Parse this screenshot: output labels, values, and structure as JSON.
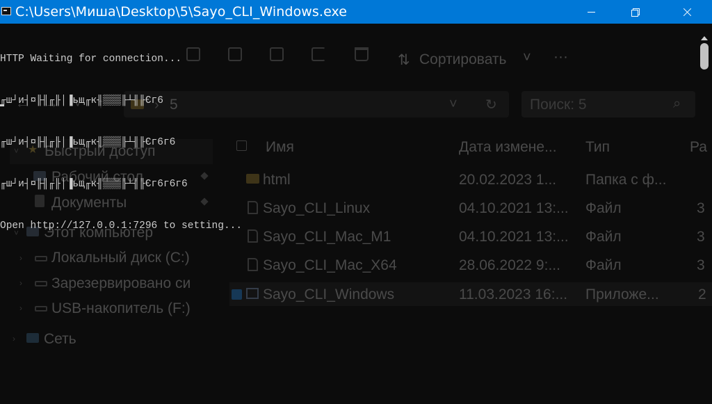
{
  "window": {
    "title": "C:\\Users\\Миша\\Desktop\\5\\Sayo_CLI_Windows.exe",
    "icon": "console-app-icon",
    "accent_color": "#0078d7"
  },
  "console": {
    "lines": [
      "HTTP Waiting for connection...",
      "╓ш┘и┤¤╟╢╓╟│▐ьщ╓к╢▒▒▒╟┴╢╟Єг6",
      "╓ш┘и┤¤╟╢╓╟│▐ьщ╓к╢▒▒▒╟┴╢╟Єг6г6",
      "╓ш┘и┤¤╟╢╓╟│▐ьщ╓к╢▒▒▒╟┴╢╟Єг6г6г6",
      "Open http://127.0.0.1:7296 to setting..."
    ],
    "text_color": "#cccccc",
    "background": "#0c0c0c"
  },
  "explorer": {
    "toolbar": {
      "sort_label": "Сортировать",
      "more_label": "···"
    },
    "address": {
      "path_segment": "5",
      "search_placeholder": "Поиск: 5"
    },
    "nav": {
      "quick_access": "Быстрый доступ",
      "desktop": "Рабочий стол",
      "documents": "Документы",
      "this_pc": "Этот компьютер",
      "local_disk": "Локальный диск (C:)",
      "reserved": "Зарезервировано си",
      "usb": "USB-накопитель (F:)",
      "network": "Сеть"
    },
    "columns": {
      "name": "Имя",
      "date": "Дата измене...",
      "type": "Тип",
      "size": "Ра"
    },
    "files": [
      {
        "name": "html",
        "date": "20.02.2023 1...",
        "type": "Папка с ф...",
        "size": ""
      },
      {
        "name": "Sayo_CLI_Linux",
        "date": "04.10.2021 13:...",
        "type": "Файл",
        "size": "3"
      },
      {
        "name": "Sayo_CLI_Mac_M1",
        "date": "04.10.2021 13:...",
        "type": "Файл",
        "size": "3"
      },
      {
        "name": "Sayo_CLI_Mac_X64",
        "date": "28.06.2022 9:...",
        "type": "Файл",
        "size": "3"
      },
      {
        "name": "Sayo_CLI_Windows",
        "date": "11.03.2023 16:...",
        "type": "Приложе...",
        "size": "2"
      }
    ]
  }
}
